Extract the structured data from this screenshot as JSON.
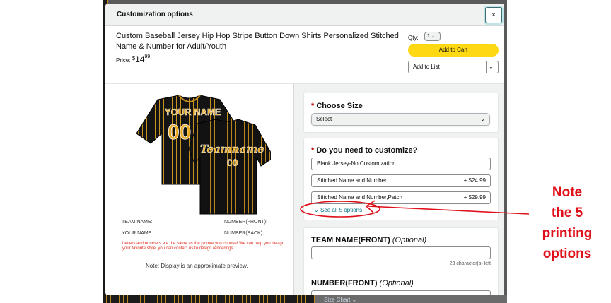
{
  "modal": {
    "title": "Customization options",
    "close_symbol": "×"
  },
  "product": {
    "title": "Custom Baseball Jersey Hip Hop Stripe Button Down Shirts Personalized Stitched Name & Number for Adult/Youth",
    "price_label": "Price:",
    "price_symbol": "$",
    "price_whole": "14",
    "price_fraction": "99"
  },
  "buy_box": {
    "qty_label": "Qty:",
    "qty_value": "1",
    "add_to_cart": "Add to Cart",
    "add_to_list": "Add to List"
  },
  "preview": {
    "jersey_front_text": "YOUR NAME",
    "jersey_front_number": "00",
    "jersey_back_text": "Teamname",
    "jersey_back_number": "00",
    "team_name_label": "TEAM NAME:",
    "your_name_label": "YOUR NAME:",
    "number_front_label": "NUMBER(FRONT):",
    "number_back_label": "NUMBER(BACK):",
    "disclaimer": "Letters and numbers are the same as the picture you choose! We can help you design your favorite style, you can contact us to design renderings.",
    "approx_note": "Note: Display is an approximate preview."
  },
  "size_section": {
    "title": "Choose Size",
    "select_value": "Select"
  },
  "customize_section": {
    "title": "Do you need to customize?",
    "options": [
      {
        "label": "Blank Jersey-No Customization",
        "price": ""
      },
      {
        "label": "Stitched Name and Number",
        "price": "+ $24.99"
      },
      {
        "label": "Stitched Name and Number,Patch",
        "price": "+ $29.99"
      }
    ],
    "see_all": "See all 5 options"
  },
  "fields": {
    "team_name_title": "TEAM NAME(FRONT)",
    "optional": "(Optional)",
    "team_name_chars_left": "23 character(s) left",
    "number_front_title": "NUMBER(FRONT)"
  },
  "background": {
    "size_chart": "Size Chart"
  },
  "annotation": {
    "lines": [
      "Note",
      "the 5",
      "printing",
      "options"
    ],
    "color": "#e0101a"
  },
  "colors": {
    "cart_button": "#ffd814",
    "link": "#007185",
    "required": "#c40000"
  }
}
